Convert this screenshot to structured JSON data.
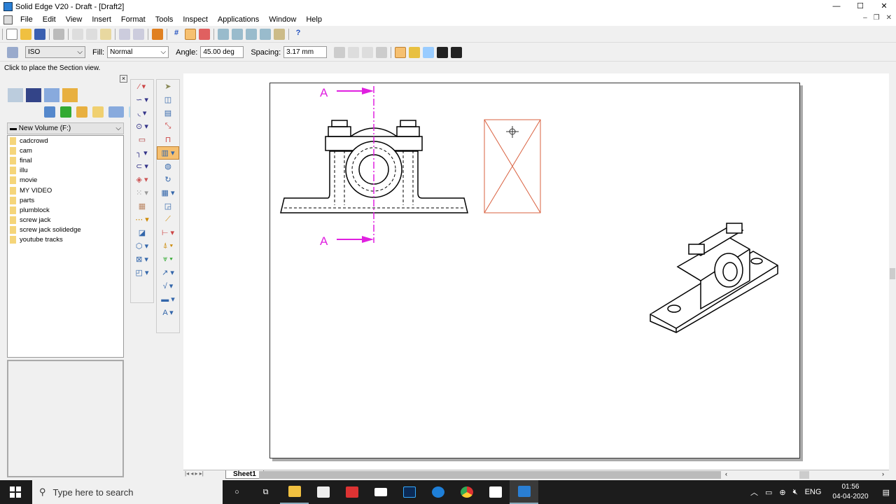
{
  "window": {
    "title": "Solid Edge V20 - Draft - [Draft2]",
    "min": "—",
    "max": "☐",
    "close": "✕"
  },
  "menu": [
    "File",
    "Edit",
    "View",
    "Insert",
    "Format",
    "Tools",
    "Inspect",
    "Applications",
    "Window",
    "Help"
  ],
  "ribbon": {
    "style": "ISO",
    "fill_label": "Fill:",
    "fill": "Normal",
    "angle_label": "Angle:",
    "angle": "45.00 deg",
    "spacing_label": "Spacing:",
    "spacing": "3.17 mm"
  },
  "status": "Click to place the Section view.",
  "library": {
    "drive": "New Volume (F:)",
    "folders": [
      "cadcrowd",
      "cam",
      "final",
      "illu",
      "movie",
      "MY VIDEO",
      "parts",
      "plumblock",
      "screw jack",
      "screw jack solidedge",
      "youtube tracks"
    ]
  },
  "drawing": {
    "section_label": "A",
    "cutting_plane_color": "#e020e0",
    "preview_color": "#d9603f"
  },
  "sheet_tab": "Sheet1",
  "taskbar": {
    "search_placeholder": "Type here to search",
    "lang": "ENG",
    "time": "01:56",
    "date": "04-04-2020"
  }
}
